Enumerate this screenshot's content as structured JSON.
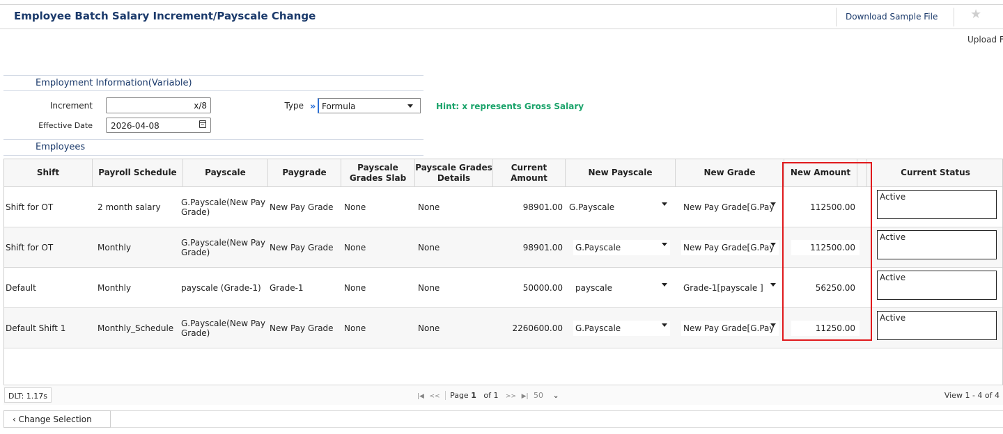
{
  "header": {
    "title": "Employee Batch Salary Increment/Payscale Change",
    "download_label": "Download Sample File",
    "upload_label": "Upload F"
  },
  "employment_info": {
    "title": "Employment Information(Variable)",
    "increment_label": "Increment",
    "increment_value": "x/8",
    "type_label": "Type",
    "type_value": "Formula",
    "effective_date_label": "Effective Date",
    "effective_date_value": "2026-04-08",
    "hint": "Hint: x represents Gross Salary"
  },
  "employees": {
    "title": "Employees",
    "columns": {
      "shift": "Shift",
      "payroll_schedule": "Payroll Schedule",
      "payscale": "Payscale",
      "paygrade": "Paygrade",
      "grades_slab": "Payscale Grades Slab",
      "grades_details": "Payscale Grades Details",
      "current_amount": "Current Amount",
      "new_payscale": "New Payscale",
      "new_grade": "New Grade",
      "new_amount": "New Amount",
      "current_status": "Current Status"
    },
    "rows": [
      {
        "shift": "Shift for OT",
        "payroll_schedule": "2 month salary",
        "payscale": "G.Payscale(New Pay Grade)",
        "paygrade": "New Pay Grade",
        "grades_slab": "None",
        "grades_details": "None",
        "current_amount": "98901.00",
        "new_payscale": "G.Payscale",
        "new_grade": "New Pay Grade[G.Pay",
        "new_amount": "112500.00",
        "current_status": "Active"
      },
      {
        "shift": "Shift for OT",
        "payroll_schedule": "Monthly",
        "payscale": "G.Payscale(New Pay Grade)",
        "paygrade": "New Pay Grade",
        "grades_slab": "None",
        "grades_details": "None",
        "current_amount": "98901.00",
        "new_payscale": "G.Payscale",
        "new_grade": "New Pay Grade[G.Pay",
        "new_amount": "112500.00",
        "current_status": "Active"
      },
      {
        "shift": "Default",
        "payroll_schedule": "Monthly",
        "payscale": "payscale (Grade-1)",
        "paygrade": "Grade-1",
        "grades_slab": "None",
        "grades_details": "None",
        "current_amount": "50000.00",
        "new_payscale": "payscale",
        "new_grade": "Grade-1[payscale ]",
        "new_amount": "56250.00",
        "current_status": "Active"
      },
      {
        "shift": "Default Shift 1",
        "payroll_schedule": "Monthly_Schedule",
        "payscale": "G.Payscale(New Pay Grade)",
        "paygrade": "New Pay Grade",
        "grades_slab": "None",
        "grades_details": "None",
        "current_amount": "2260600.00",
        "new_payscale": "G.Payscale",
        "new_grade": "New Pay Grade[G.Pay",
        "new_amount": "11250.00",
        "current_status": "Active"
      }
    ]
  },
  "footer": {
    "dlt": "DLT: 1.17s",
    "page_label": "Page",
    "page_number": "1",
    "of_label": "of 1",
    "page_size": "50",
    "view_text": "View 1 - 4 of 4"
  },
  "actions": {
    "change_selection": "Change Selection"
  },
  "colors": {
    "title_blue": "#1b3a6b",
    "hint_green": "#1aa36a",
    "highlight_red": "#e0191c"
  }
}
